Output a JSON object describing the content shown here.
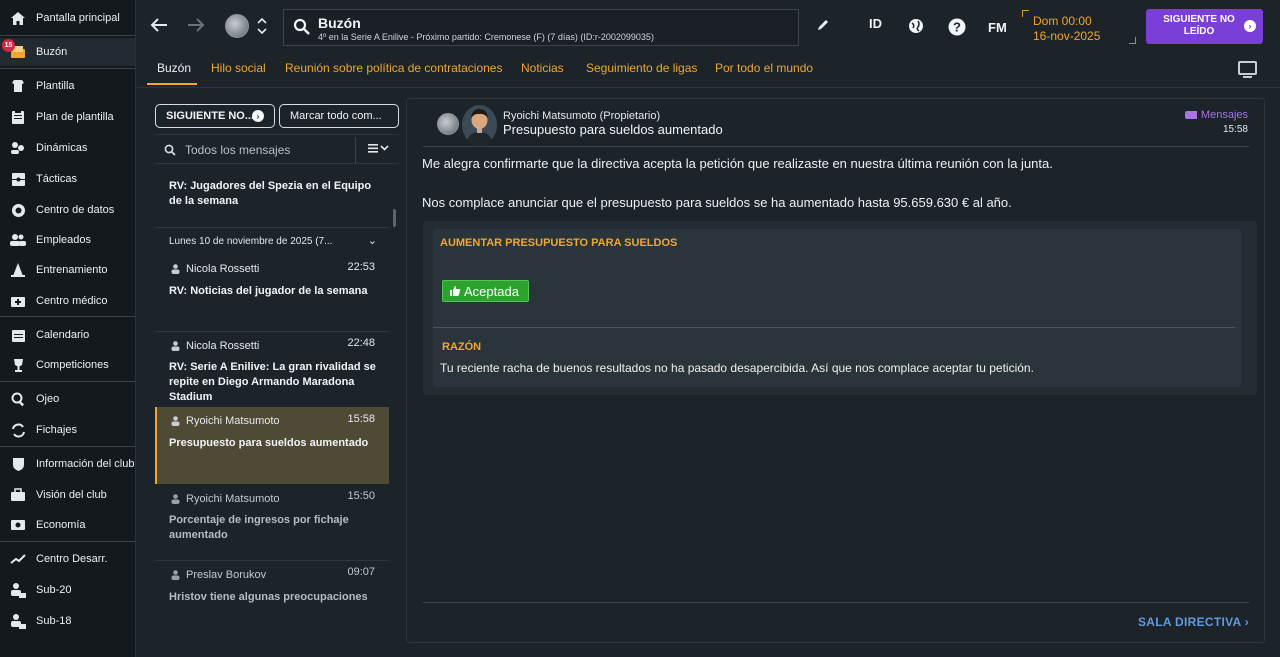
{
  "sidebar": {
    "items": [
      {
        "label": "Pantalla principal",
        "icon": "home-icon"
      },
      {
        "label": "Buzón",
        "icon": "inbox-icon",
        "badge": "15"
      },
      {
        "label": "Plantilla",
        "icon": "squad-icon"
      },
      {
        "label": "Plan de plantilla",
        "icon": "clipboard-icon"
      },
      {
        "label": "Dinámicas",
        "icon": "dynamics-icon"
      },
      {
        "label": "Tácticas",
        "icon": "tactics-icon"
      },
      {
        "label": "Centro de datos",
        "icon": "data-hub-icon"
      },
      {
        "label": "Empleados",
        "icon": "staff-icon"
      },
      {
        "label": "Entrenamiento",
        "icon": "training-cone-icon"
      },
      {
        "label": "Centro médico",
        "icon": "medical-kit-icon"
      },
      {
        "label": "Calendario",
        "icon": "calendar-icon"
      },
      {
        "label": "Competiciones",
        "icon": "trophy-icon"
      },
      {
        "label": "Ojeo",
        "icon": "scouting-magnifier-icon"
      },
      {
        "label": "Fichajes",
        "icon": "transfers-icon"
      },
      {
        "label": "Información del club",
        "icon": "club-shield-icon"
      },
      {
        "label": "Visión del club",
        "icon": "briefcase-icon"
      },
      {
        "label": "Economía",
        "icon": "finances-icon"
      },
      {
        "label": "Centro Desarr.",
        "icon": "development-icon"
      },
      {
        "label": "Sub-20",
        "icon": "u20-icon"
      },
      {
        "label": "Sub-18",
        "icon": "u18-icon"
      }
    ]
  },
  "topbar": {
    "title": "Buzón",
    "subtitle": "4º en la Serie A Enilive - Próximo partido: Cremonese (F) (7 días) (ID:r-2002099035)",
    "id_label": "ID",
    "fm_label": "FM",
    "date_line1": "Dom 00:00",
    "date_line2": "16-nov-2025",
    "next_unread_label": "SIGUIENTE NO LEÍDO"
  },
  "tabs": [
    {
      "label": "Buzón",
      "active": true
    },
    {
      "label": "Hilo social",
      "active": false
    },
    {
      "label": "Reunión sobre política de contrataciones",
      "active": false
    },
    {
      "label": "Noticias",
      "active": false
    },
    {
      "label": "Seguimiento de ligas",
      "active": false
    },
    {
      "label": "Por todo el mundo",
      "active": false
    }
  ],
  "list": {
    "next_button": "SIGUIENTE NO...",
    "mark_button": "Marcar todo com...",
    "filter_placeholder": "Todos los mensajes",
    "date_group": "Lunes 10 de noviembre de 2025 (7...",
    "messages": [
      {
        "sender": "",
        "time": "",
        "subject": "RV: Jugadores del Spezia en el Equipo de la semana",
        "read": false
      },
      {
        "sender": "Nicola Rossetti",
        "time": "22:53",
        "subject": "RV: Noticias del jugador de la semana",
        "read": false
      },
      {
        "sender": "Nicola Rossetti",
        "time": "22:48",
        "subject": "RV: Serie A Enilive: La gran rivalidad se repite en Diego Armando Maradona Stadium",
        "read": false
      },
      {
        "sender": "Ryoichi Matsumoto",
        "time": "15:58",
        "subject": "Presupuesto para sueldos aumentado",
        "read": false,
        "selected": true
      },
      {
        "sender": "Ryoichi Matsumoto",
        "time": "15:50",
        "subject": "Porcentaje de ingresos por fichaje aumentado",
        "read": true
      },
      {
        "sender": "Preslav Borukov",
        "time": "09:07",
        "subject": "Hristov tiene algunas preocupaciones",
        "read": true
      }
    ]
  },
  "reading": {
    "from": "Ryoichi Matsumoto  (Propietario)",
    "subject": "Presupuesto para sueldos aumentado",
    "category": "Mensajes",
    "time": "15:58",
    "paragraph1": "Me alegra confirmarte que la directiva acepta la petición que realizaste en nuestra última reunión con la junta.",
    "paragraph2": "Nos complace anunciar que el presupuesto para sueldos se ha aumentado hasta 95.659.630 € al año.",
    "outcome_title": "AUMENTAR PRESUPUESTO PARA SUELDOS",
    "outcome_status": "Aceptada",
    "reason_title": "RAZÓN",
    "reason_text": "Tu reciente racha de buenos resultados no ha pasado desapercibida. Así que nos complace aceptar tu petición.",
    "board_link": "SALA DIRECTIVA"
  },
  "colors": {
    "accent": "#f0a732",
    "primary_button": "#7a3fd6",
    "accepted": "#2ca32c",
    "link": "#5f9be0"
  }
}
